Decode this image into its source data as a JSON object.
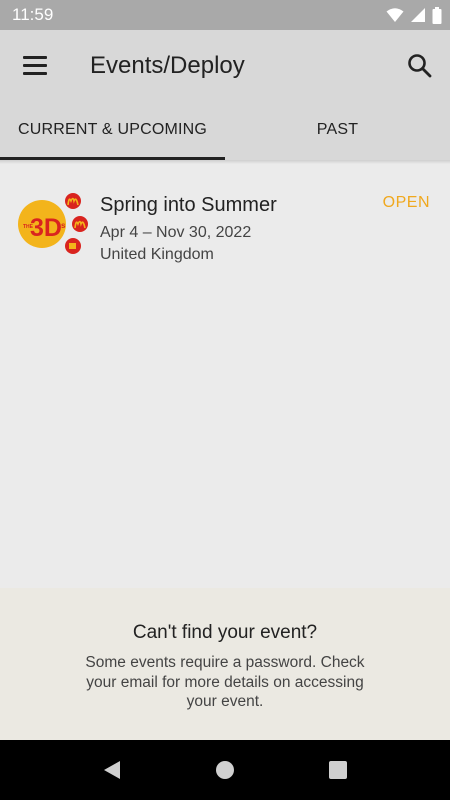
{
  "status_bar": {
    "time": "11:59",
    "icons": [
      "wifi-icon",
      "signal-icon",
      "battery-icon"
    ]
  },
  "app_bar": {
    "title": "Events/Deploy",
    "menu_icon": "hamburger-menu-icon",
    "search_icon": "search-icon"
  },
  "tabs": [
    {
      "label": "CURRENT & UPCOMING",
      "active": true
    },
    {
      "label": "PAST",
      "active": false
    }
  ],
  "events": [
    {
      "name": "Spring into Summer",
      "dates": "Apr 4 – Nov 30, 2022",
      "location": "United Kingdom",
      "status": "OPEN",
      "logo_text": "3D",
      "logo_small_text": "THE",
      "logo_suffix": "s"
    }
  ],
  "help": {
    "title": "Can't find your event?",
    "text": "Some events require a password. Check your email for more details on accessing your event."
  },
  "nav_bar": {
    "buttons": [
      "back-icon",
      "home-icon",
      "recents-icon"
    ]
  },
  "colors": {
    "status_bar": "#a9a9a9",
    "app_bar": "#d8d8d8",
    "background": "#ebebeb",
    "accent_open": "#f0a81e",
    "help_panel": "#ebe9e2",
    "logo_yellow": "#f3b41b",
    "logo_red": "#d9241f"
  }
}
